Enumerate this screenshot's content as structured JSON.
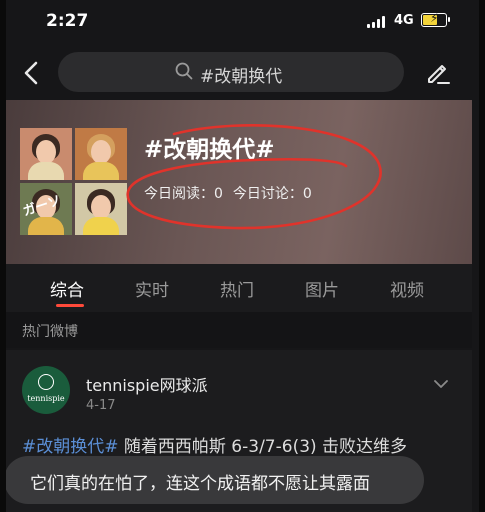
{
  "status_bar": {
    "time": "2:27",
    "network": "4G"
  },
  "header": {
    "search_text": "#改朝换代"
  },
  "topic": {
    "title": "#改朝换代#",
    "read_label": "今日阅读：0",
    "discuss_label": "今日讨论：0",
    "photo_overlay_text": "ガーソ"
  },
  "tabs": [
    {
      "label": "综合"
    },
    {
      "label": "实时"
    },
    {
      "label": "热门"
    },
    {
      "label": "图片"
    },
    {
      "label": "视频"
    }
  ],
  "section_label": "热门微博",
  "post": {
    "author": "tennispie网球派",
    "avatar_text": "tennispie",
    "date": "4-17",
    "hashtag": "#改朝换代#",
    "text": " 随着西西帕斯 6-3/7-6(3) 击败达维多"
  },
  "caption": "它们真的在怕了，连这个成语都不愿让其露面",
  "colors": {
    "accent": "#ff4a3a",
    "link": "#5b8fd6",
    "battery": "#f2d33a",
    "annotation": "#e0332b"
  },
  "icons": [
    "back-arrow-icon",
    "search-icon",
    "edit-pencil-icon",
    "signal-icon",
    "battery-icon",
    "chevron-down-icon"
  ]
}
